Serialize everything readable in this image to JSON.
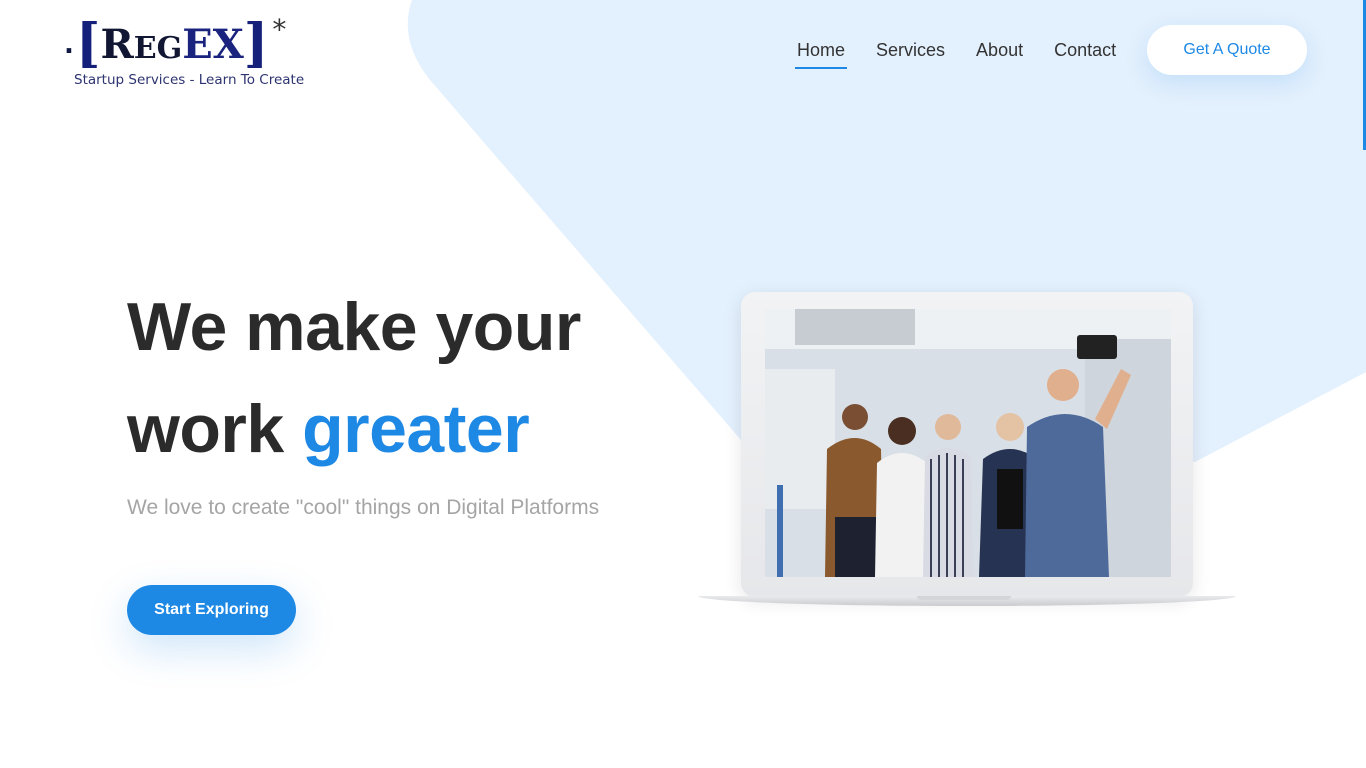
{
  "logo": {
    "dot": ".",
    "bracket_open": "[",
    "word_r": "R",
    "word_eg": "EG",
    "word_ex": "EX",
    "bracket_close": "]",
    "star": "*",
    "tagline": "Startup Services - Learn To Create"
  },
  "nav": {
    "items": [
      {
        "label": "Home",
        "active": true
      },
      {
        "label": "Services",
        "active": false
      },
      {
        "label": "About",
        "active": false
      },
      {
        "label": "Contact",
        "active": false
      }
    ],
    "quote_label": "Get A Quote"
  },
  "hero": {
    "line1": "We make your",
    "line2_plain": "work ",
    "line2_accent": "greater",
    "subtitle": "We love to create \"cool\" things on Digital Platforms",
    "cta_label": "Start Exploring"
  },
  "colors": {
    "accent": "#1e88e5",
    "background_shape": "#e3f0fd",
    "heading": "#2b2b2b",
    "subtitle": "#a5a5a5"
  },
  "image": {
    "description_icon": "group-selfie-photo"
  }
}
